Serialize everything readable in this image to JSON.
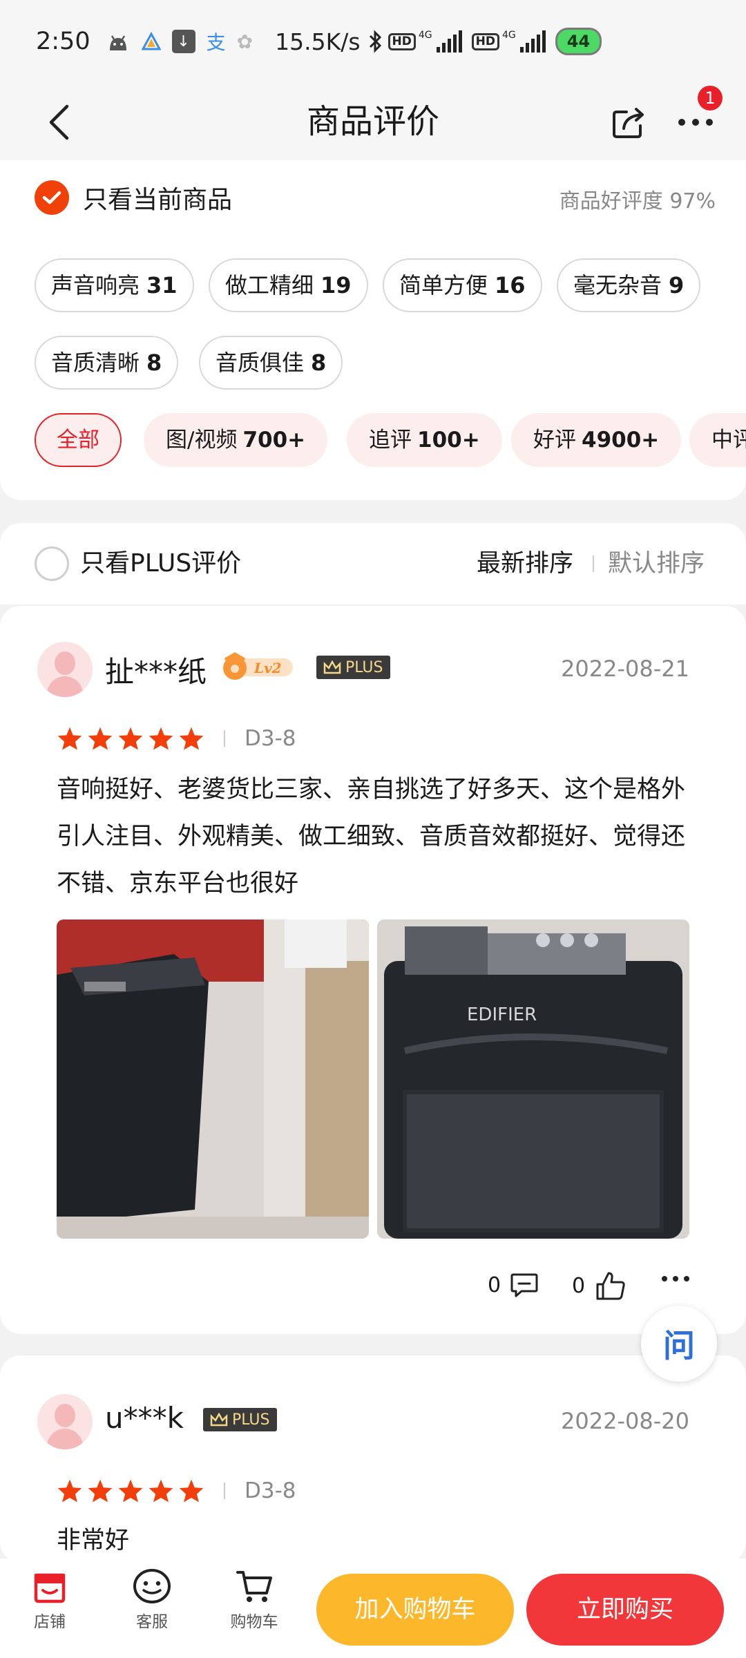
{
  "status_bar": {
    "time": "2:50",
    "net_speed": "15.5K/s",
    "signal1_label": "HD",
    "signal1_gen": "4G",
    "signal2_label": "HD",
    "signal2_gen": "4G",
    "battery": "44"
  },
  "header": {
    "title": "商品评价",
    "more_badge": "1"
  },
  "filters": {
    "current_only_label": "只看当前商品",
    "positive_rate_label": "商品好评度 97%",
    "tags": [
      {
        "label": "声音响亮",
        "count": "31"
      },
      {
        "label": "做工精细",
        "count": "19"
      },
      {
        "label": "简单方便",
        "count": "16"
      },
      {
        "label": "毫无杂音",
        "count": "9"
      },
      {
        "label": "音质清晰",
        "count": "8"
      },
      {
        "label": "音质俱佳",
        "count": "8"
      }
    ],
    "categories": [
      {
        "label": "全部",
        "count": ""
      },
      {
        "label": "图/视频",
        "count": "700+"
      },
      {
        "label": "追评",
        "count": "100+"
      },
      {
        "label": "好评",
        "count": "4900+"
      },
      {
        "label": "中评",
        "count": ""
      }
    ]
  },
  "plus_bar": {
    "plus_only_label": "只看PLUS评价",
    "sort_newest": "最新排序",
    "sort_default": "默认排序"
  },
  "reviews": [
    {
      "user": "扯***纸",
      "level_badge": "Lv2",
      "plus_badge": "PLUS",
      "date": "2022-08-21",
      "rating": 5,
      "variant": "D3-8",
      "text": "音响挺好、老婆货比三家、亲自挑选了好多天、这个是格外引人注目、外观精美、做工细致、音质音效都挺好、觉得还不错、京东平台也很好",
      "photo_brand": "EDIFIER",
      "comment_count": "0",
      "like_count": "0"
    },
    {
      "user": "u***k",
      "plus_badge": "PLUS",
      "date": "2022-08-20",
      "rating": 5,
      "variant": "D3-8",
      "text": "非常好"
    }
  ],
  "ask_button": "问",
  "bottom_bar": {
    "shop": "店铺",
    "service": "客服",
    "cart": "购物车",
    "add_to_cart": "加入购物车",
    "buy_now": "立即购买"
  },
  "colors": {
    "accent_red": "#e8202a",
    "check_orange": "#f0410a",
    "star": "#f23e0b",
    "cart_yellow": "#fdb72a",
    "buy_red": "#f2373b"
  }
}
